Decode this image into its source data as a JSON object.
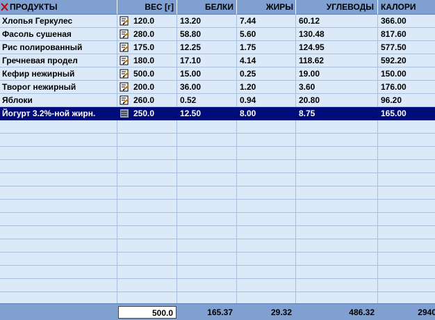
{
  "header": {
    "products": "ПРОДУКТЫ",
    "weight": "ВЕС [г]",
    "protein": "БЕЛКИ",
    "fat": "ЖИРЫ",
    "carbs": "УГЛЕВОДЫ",
    "calories": "КАЛОРИ"
  },
  "rows": [
    {
      "name": "Хлопья Геркулес",
      "weight": "120.0",
      "protein": "13.20",
      "fat": "7.44",
      "carbs": "60.12",
      "cal": "366.00"
    },
    {
      "name": "Фасоль сушеная",
      "weight": "280.0",
      "protein": "58.80",
      "fat": "5.60",
      "carbs": "130.48",
      "cal": "817.60"
    },
    {
      "name": "Рис полированный",
      "weight": "175.0",
      "protein": "12.25",
      "fat": "1.75",
      "carbs": "124.95",
      "cal": "577.50"
    },
    {
      "name": "Гречневая продел",
      "weight": "180.0",
      "protein": "17.10",
      "fat": "4.14",
      "carbs": "118.62",
      "cal": "592.20"
    },
    {
      "name": "Кефир нежирный",
      "weight": "500.0",
      "protein": "15.00",
      "fat": "0.25",
      "carbs": "19.00",
      "cal": "150.00"
    },
    {
      "name": "Творог нежирный",
      "weight": "200.0",
      "protein": "36.00",
      "fat": "1.20",
      "carbs": "3.60",
      "cal": "176.00"
    },
    {
      "name": "Яблоки",
      "weight": "260.0",
      "protein": "0.52",
      "fat": "0.94",
      "carbs": "20.80",
      "cal": "96.20"
    },
    {
      "name": "Йогурт 3.2%-ной жирн.",
      "weight": "250.0",
      "protein": "12.50",
      "fat": "8.00",
      "carbs": "8.75",
      "cal": "165.00"
    }
  ],
  "selected_row": 7,
  "footer": {
    "weight": "500.0",
    "protein": "165.37",
    "fat": "29.32",
    "carbs": "486.32",
    "cal": "2940"
  },
  "colors": {
    "background": "#dce9f8",
    "header": "#7fa0d0",
    "selection": "#000c7a",
    "gridline": "#a9bfe0"
  },
  "icons": [
    "close-icon",
    "edit-weight-icon"
  ]
}
